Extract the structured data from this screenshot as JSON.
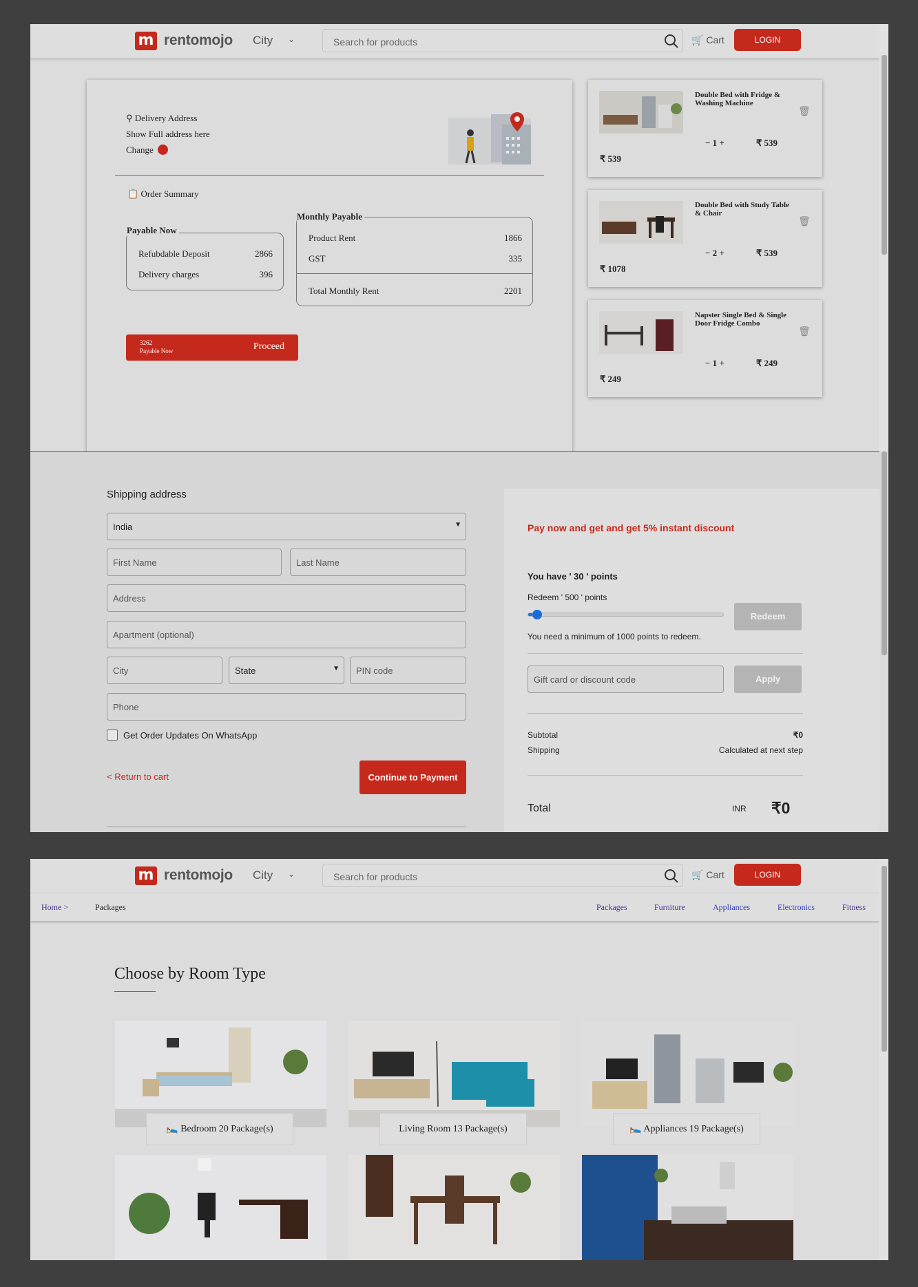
{
  "header": {
    "logo_letter": "m",
    "logo_text": "rentomojo",
    "city": "City",
    "search_placeholder": "Search for products",
    "cart": "Cart",
    "login": "LOGIN"
  },
  "cart_page": {
    "delivery_label": "Delivery Address",
    "address_text": "Show Full address here",
    "change": "Change",
    "order_summary": "Order Summary",
    "payable_now": {
      "title": "Payable Now",
      "rows": [
        {
          "label": "Refubdable Deposit",
          "value": "2866"
        },
        {
          "label": "Delivery charges",
          "value": "396"
        }
      ]
    },
    "monthly_payable": {
      "title": "Monthly Payable",
      "rows": [
        {
          "label": "Product Rent",
          "value": "1866"
        },
        {
          "label": "GST",
          "value": "335"
        }
      ],
      "total_label": "Total Monthly Rent",
      "total_value": "2201"
    },
    "proceed": {
      "amount": "3262",
      "sub": "Payable Now",
      "label": "Proceed"
    },
    "items": [
      {
        "name": "Double Bed with Fridge & Washing Machine",
        "qty": "1",
        "unit_price": "₹ 539",
        "total": "₹ 539"
      },
      {
        "name": "Double Bed with Study Table & Chair",
        "qty": "2",
        "unit_price": "₹ 539",
        "total": "₹ 1078"
      },
      {
        "name": "Napster Single Bed & Single Door Fridge Combo",
        "qty": "1",
        "unit_price": "₹ 249",
        "total": "₹ 249"
      }
    ]
  },
  "checkout": {
    "shipping_title": "Shipping address",
    "country": "India",
    "first_name": "First Name",
    "last_name": "Last Name",
    "address": "Address",
    "apartment": "Apartment (optional)",
    "city": "City",
    "state": "State",
    "pin": "PIN code",
    "phone": "Phone",
    "whatsapp": "Get Order Updates On WhatsApp",
    "return": "< Return to cart",
    "continue": "Continue to Payment",
    "discount_msg": "Pay now and get and get 5% instant discount",
    "points_have": "You have ' 30 ' points",
    "redeem_label": "Redeem ' 500 ' points",
    "redeem_btn": "Redeem",
    "min_msg": "You need a minimum of 1000 points to redeem.",
    "slider_value": 0.02,
    "gift_placeholder": "Gift card or discount code",
    "apply": "Apply",
    "subtotal_label": "Subtotal",
    "subtotal": "₹0",
    "shipping_label": "Shipping",
    "shipping_value": "Calculated at next step",
    "total_label": "Total",
    "currency": "INR",
    "total": "₹0"
  },
  "packages": {
    "breadcrumb_home": "Home >",
    "breadcrumb_current": "Packages",
    "nav": [
      "Packages",
      "Furniture",
      "Appliances",
      "Electronics",
      "Fitness"
    ],
    "title": "Choose by Room Type",
    "rooms": [
      {
        "label": "Bedroom 20 Package(s)"
      },
      {
        "label": "Living Room 13 Package(s)"
      },
      {
        "label": "Appliances 19 Package(s)"
      }
    ]
  },
  "colors": {
    "brand_red": "#c4291c",
    "link_purple": "#4b2c8a",
    "link_blue": "#2b3bc0"
  }
}
